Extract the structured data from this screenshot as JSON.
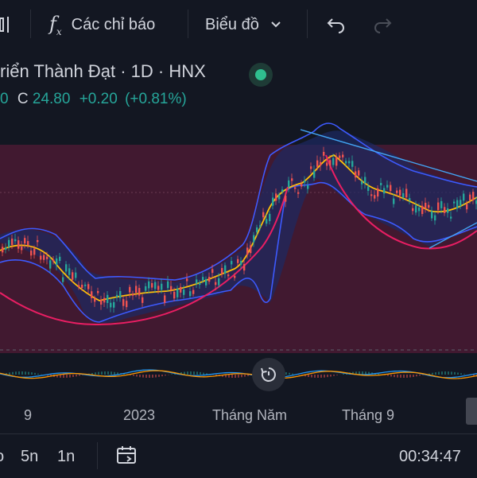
{
  "toolbar": {
    "indicators_label": "Các chỉ báo",
    "chart_type_label": "Biểu đồ"
  },
  "symbol": {
    "title": "riển Thành Đạt · 1D · HNX"
  },
  "ohlc": {
    "partial_label": "0",
    "close_label": "C",
    "close_value": "24.80",
    "change": "+0.20",
    "change_pct": "(+0.81%)"
  },
  "time_axis": {
    "labels": [
      "9",
      "2023",
      "Tháng Năm",
      "Tháng 9"
    ]
  },
  "bottom_bar": {
    "range_5y": "5n",
    "range_1y": "1n",
    "clock": "00:34:47"
  },
  "colors": {
    "background": "#131722",
    "up": "#26a69a",
    "down": "#ef5350",
    "zone": "#4a1a33",
    "bollinger": "#3d5afe",
    "ma": "#ffc107",
    "cup_curve": "#e91e63",
    "trendline": "#42a5f5"
  },
  "icons": {
    "indicators": "fx-icon",
    "chart_type": "chevron-down-icon",
    "undo": "undo-icon",
    "redo": "redo-icon",
    "status": "status-dot-icon",
    "replay": "replay-icon",
    "date_range": "calendar-range-icon"
  }
}
